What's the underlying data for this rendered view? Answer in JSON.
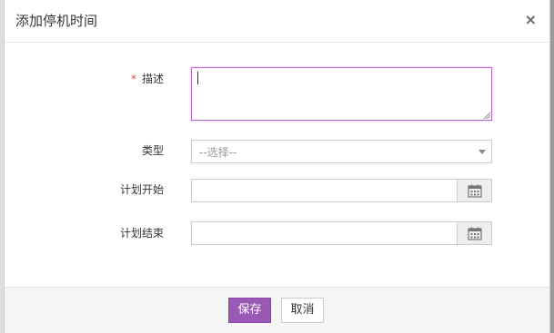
{
  "dialog": {
    "title": "添加停机时间",
    "close_glyph": "×"
  },
  "form": {
    "description": {
      "required_mark": "*",
      "label": "描述",
      "value": ""
    },
    "type": {
      "label": "类型",
      "selected": "--选择--"
    },
    "plan_start": {
      "label": "计划开始",
      "value": "",
      "icon": "calendar-icon"
    },
    "plan_end": {
      "label": "计划结束",
      "value": "",
      "icon": "calendar-icon"
    }
  },
  "footer": {
    "save_label": "保存",
    "cancel_label": "取消"
  },
  "colors": {
    "accent": "#9b59b6",
    "focus_border": "#b96bd1",
    "required": "#e24b4b"
  }
}
